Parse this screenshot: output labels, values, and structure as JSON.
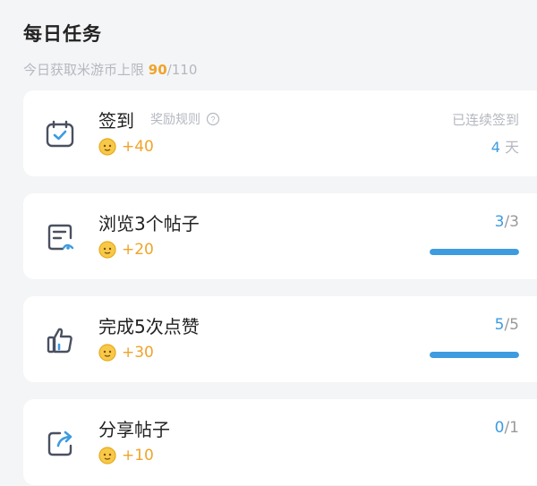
{
  "header": {
    "title": "每日任务",
    "limit_label": "今日获取米游币上限",
    "current": "90",
    "separator": "/",
    "max": "110"
  },
  "colors": {
    "accent_blue": "#3d9be0",
    "coin_orange": "#f0a32a"
  },
  "tasks": [
    {
      "name": "签到",
      "reward": "+40",
      "rule_label": "奖励规则",
      "streak_label": "已连续签到",
      "streak_days": "4",
      "streak_unit": "天",
      "icon": "calendar-check-icon"
    },
    {
      "name": "浏览3个帖子",
      "reward": "+20",
      "done": "3",
      "sep": "/",
      "total": "3",
      "progress_fraction": 1.0,
      "icon": "document-view-icon"
    },
    {
      "name": "完成5次点赞",
      "reward": "+30",
      "done": "5",
      "sep": "/",
      "total": "5",
      "progress_fraction": 1.0,
      "icon": "thumbs-up-icon"
    },
    {
      "name": "分享帖子",
      "reward": "+10",
      "done": "0",
      "sep": "/",
      "total": "1",
      "icon": "share-icon"
    }
  ]
}
